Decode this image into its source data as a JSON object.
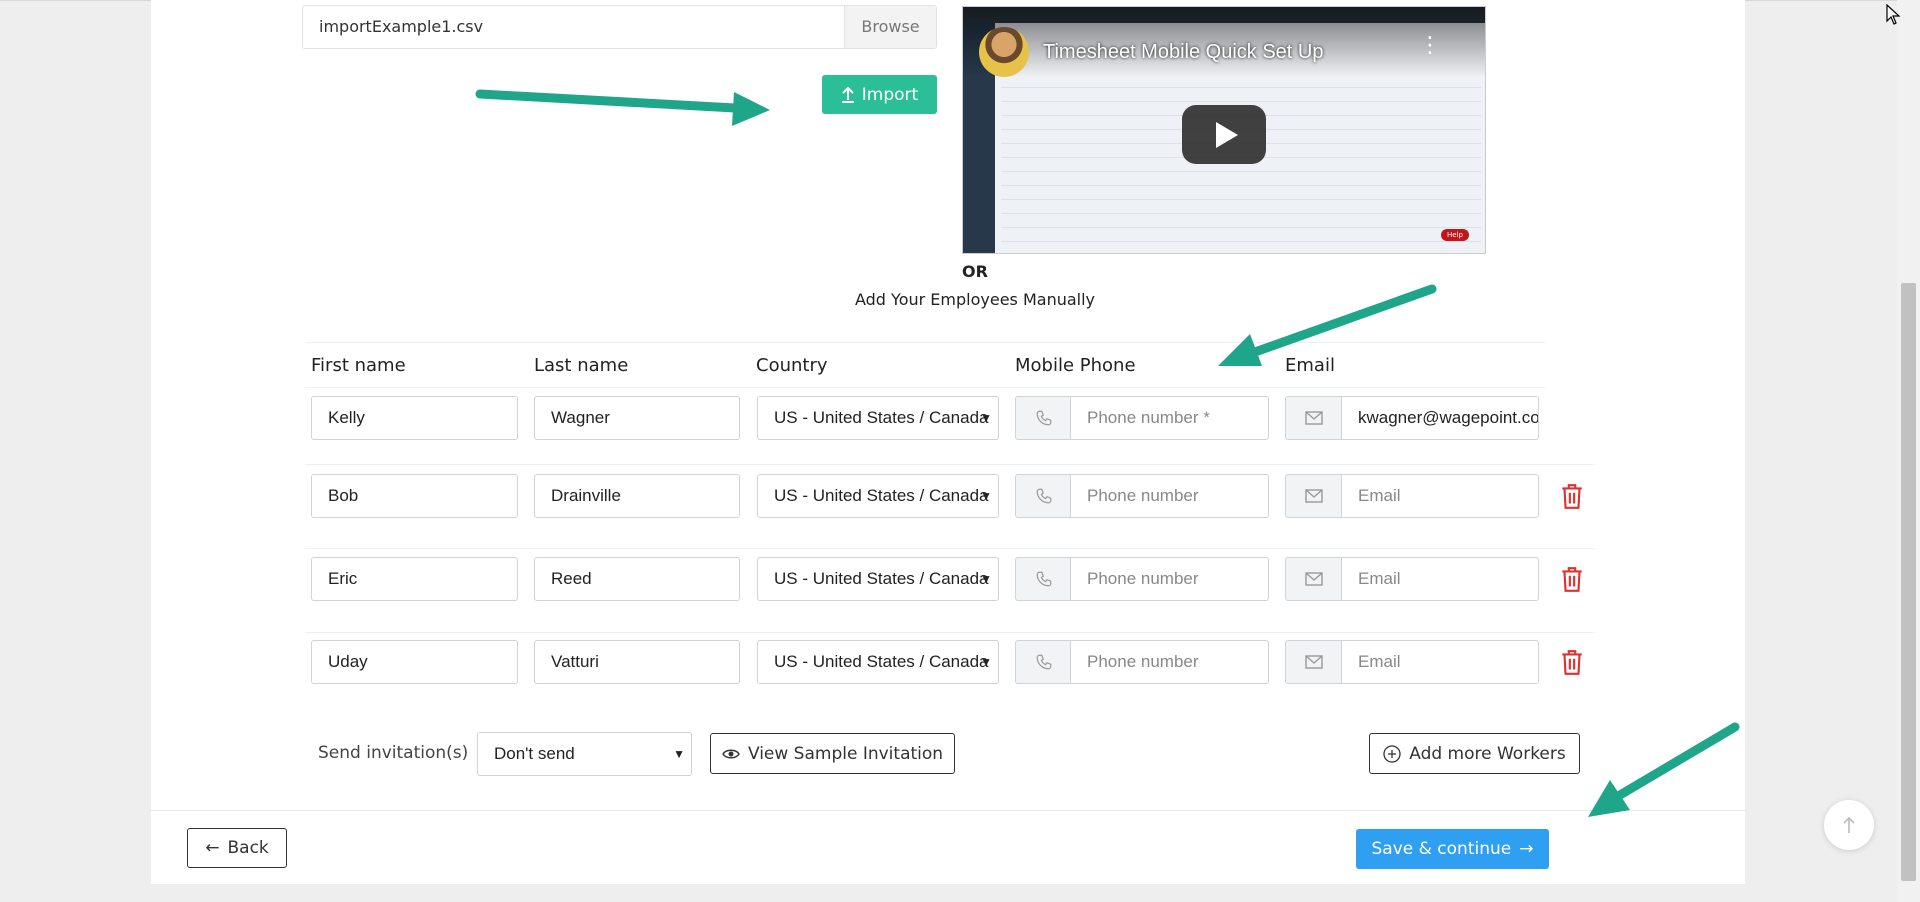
{
  "upload": {
    "file_name": "importExample1.csv",
    "browse_label": "Browse",
    "import_label": "Import"
  },
  "video": {
    "title": "Timesheet Mobile Quick Set Up",
    "help_label": "Help"
  },
  "divider": {
    "or": "OR",
    "manual_label": "Add Your Employees Manually"
  },
  "table": {
    "headers": {
      "first": "First name",
      "last": "Last name",
      "country": "Country",
      "phone": "Mobile Phone",
      "email": "Email"
    },
    "rows": [
      {
        "first": "Kelly",
        "last": "Wagner",
        "country": "US - United States / Canada",
        "phone": "",
        "phone_placeholder": "Phone number *",
        "email": "kwagner@wagepoint.com",
        "email_placeholder": "Email"
      },
      {
        "first": "Bob",
        "last": "Drainville",
        "country": "US - United States / Canada",
        "phone": "",
        "phone_placeholder": "Phone number",
        "email": "",
        "email_placeholder": "Email"
      },
      {
        "first": "Eric",
        "last": "Reed",
        "country": "US - United States / Canada",
        "phone": "",
        "phone_placeholder": "Phone number",
        "email": "",
        "email_placeholder": "Email"
      },
      {
        "first": "Uday",
        "last": "Vatturi",
        "country": "US - United States / Canada",
        "phone": "",
        "phone_placeholder": "Phone number",
        "email": "",
        "email_placeholder": "Email"
      }
    ]
  },
  "invitation": {
    "label": "Send invitation(s)",
    "selected": "Don't send",
    "view_sample_label": "View Sample Invitation",
    "add_more_label": "Add more Workers"
  },
  "footer": {
    "back_label": "Back",
    "save_label": "Save & continue"
  },
  "colors": {
    "accent_green": "#2bbf97",
    "primary_blue": "#2f9ff2",
    "danger_red": "#e0302f"
  }
}
